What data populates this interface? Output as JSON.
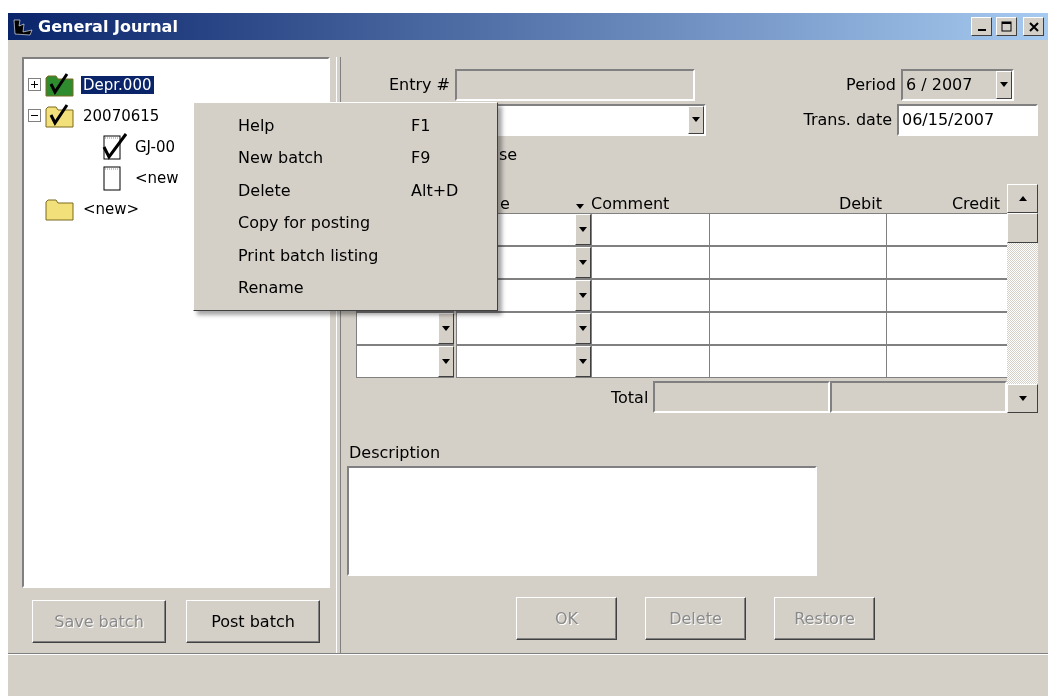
{
  "window": {
    "title": "General Journal"
  },
  "tree": [
    {
      "label": "Depr.000",
      "kind": "folder",
      "color": "#2e8b2e",
      "checked": true,
      "selected": true,
      "expanded": false
    },
    {
      "label": "20070615",
      "kind": "folder",
      "color": "#f2e07a",
      "checked": true,
      "selected": false,
      "expanded": true,
      "children": [
        {
          "label": "GJ-00",
          "kind": "document",
          "checked": true,
          "selected": false
        },
        {
          "label": "<new",
          "kind": "document",
          "checked": false,
          "selected": false
        }
      ]
    },
    {
      "label": "<new>",
      "kind": "folder",
      "color": "#f2e07a",
      "checked": false,
      "selected": false
    }
  ],
  "left_buttons": [
    {
      "label": "Save batch",
      "disabled": true
    },
    {
      "label": "Post batch",
      "disabled": false
    }
  ],
  "context_menu": [
    {
      "label": "Help",
      "shortcut": "F1"
    },
    {
      "label": "New batch",
      "shortcut": "F9"
    },
    {
      "label": "Delete",
      "shortcut": "Alt+D"
    },
    {
      "label": "Copy for posting"
    },
    {
      "label": "Print batch listing"
    },
    {
      "label": "Rename"
    }
  ],
  "entry": {
    "label": "Entry #",
    "disabled": true
  },
  "period": {
    "label": "Period",
    "value": "6 / 2007",
    "disabled": true
  },
  "trans_date": {
    "label": "Trans. date",
    "value": "06/15/2007",
    "disabled": false
  },
  "partial_label": "se",
  "grid": {
    "columns": [
      "e",
      "Comment",
      "Debit",
      "Credit"
    ],
    "total_label": "Total"
  },
  "description": {
    "label": "Description"
  },
  "buttons": [
    {
      "label": "OK",
      "disabled": true
    },
    {
      "label": "Delete",
      "disabled": true
    },
    {
      "label": "Restore",
      "disabled": true
    }
  ]
}
